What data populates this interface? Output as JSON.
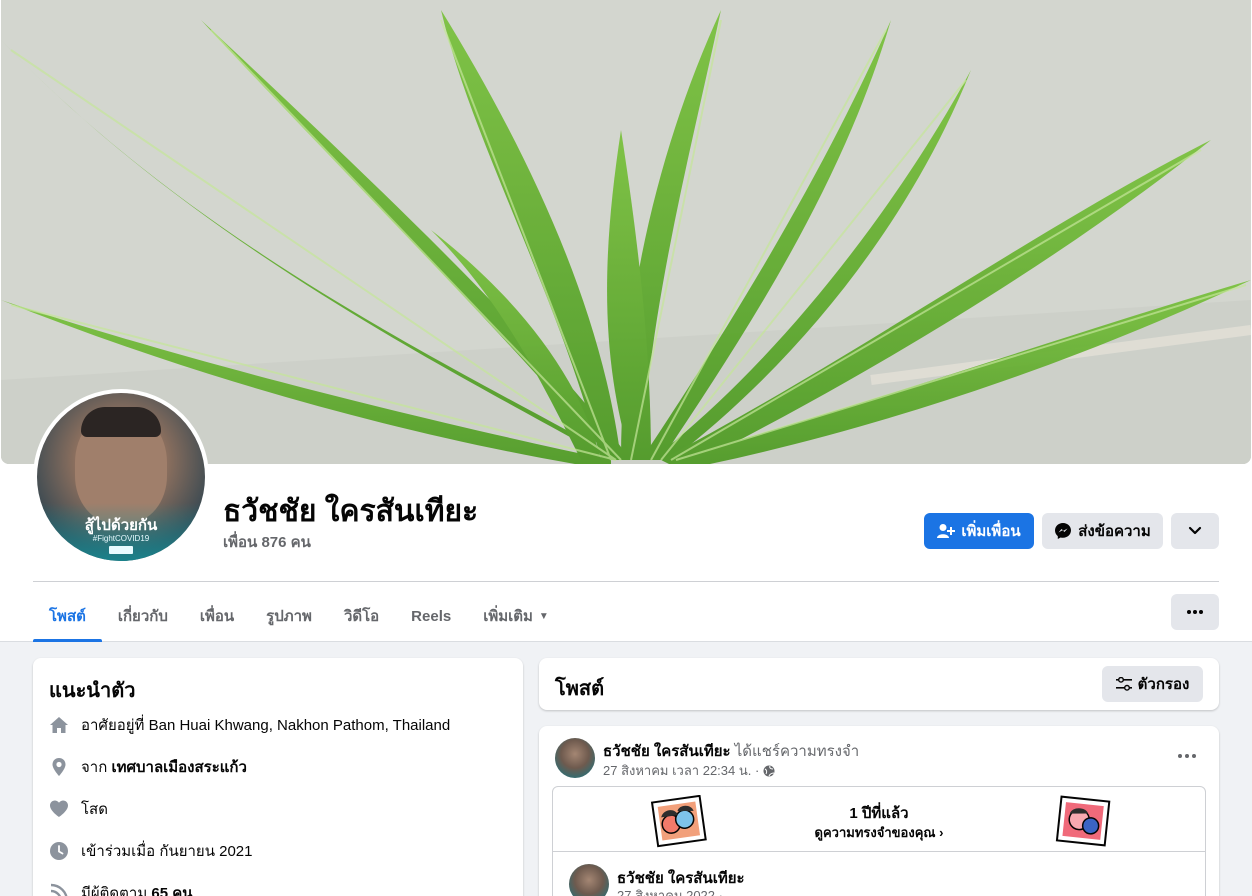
{
  "profile": {
    "name": "ธวัชชัย ใครสันเทียะ",
    "friends": "เพื่อน 876 คน",
    "avatar_frame_title": "สู้ไปด้วยกัน",
    "avatar_frame_sub": "#FightCOVID19"
  },
  "actions": {
    "add_friend": "เพิ่มเพื่อน",
    "message": "ส่งข้อความ"
  },
  "tabs": [
    {
      "label": "โพสต์",
      "active": true
    },
    {
      "label": "เกี่ยวกับ"
    },
    {
      "label": "เพื่อน"
    },
    {
      "label": "รูปภาพ"
    },
    {
      "label": "วิดีโอ"
    },
    {
      "label": "Reels"
    },
    {
      "label": "เพิ่มเติม"
    }
  ],
  "intro": {
    "title": "แนะนำตัว",
    "lives_prefix": "อาศัยอยู่ที่ ",
    "lives_place": "Ban Huai Khwang, Nakhon Pathom, Thailand",
    "from_prefix": "จาก ",
    "from_place": "เทศบาลเมืองสระแก้ว",
    "relationship": "โสด",
    "joined": "เข้าร่วมเมื่อ กันยายน 2021",
    "followers_prefix": "มีผู้ติดตาม ",
    "followers_count": "65 คน"
  },
  "posts": {
    "title": "โพสต์",
    "filter_label": "ตัวกรอง"
  },
  "post": {
    "author": "ธวัชชัย ใครสันเทียะ",
    "action": " ได้แชร์ความทรงจำ",
    "time": "27 สิงหาคม เวลา 22:34 น. ·",
    "memory_years": "1 ปีที่แล้ว",
    "memory_link": "ดูความทรงจำของคุณ",
    "shared_author": "ธวัชชัย ใครสันเทียะ",
    "shared_time": "27 สิงหาคม 2022 ·"
  },
  "colors": {
    "accent": "#1b74e4",
    "background": "#f0f2f5",
    "muted_text": "#65676b",
    "button_grey": "#e4e6eb",
    "leaf_green": "#5fa531"
  }
}
